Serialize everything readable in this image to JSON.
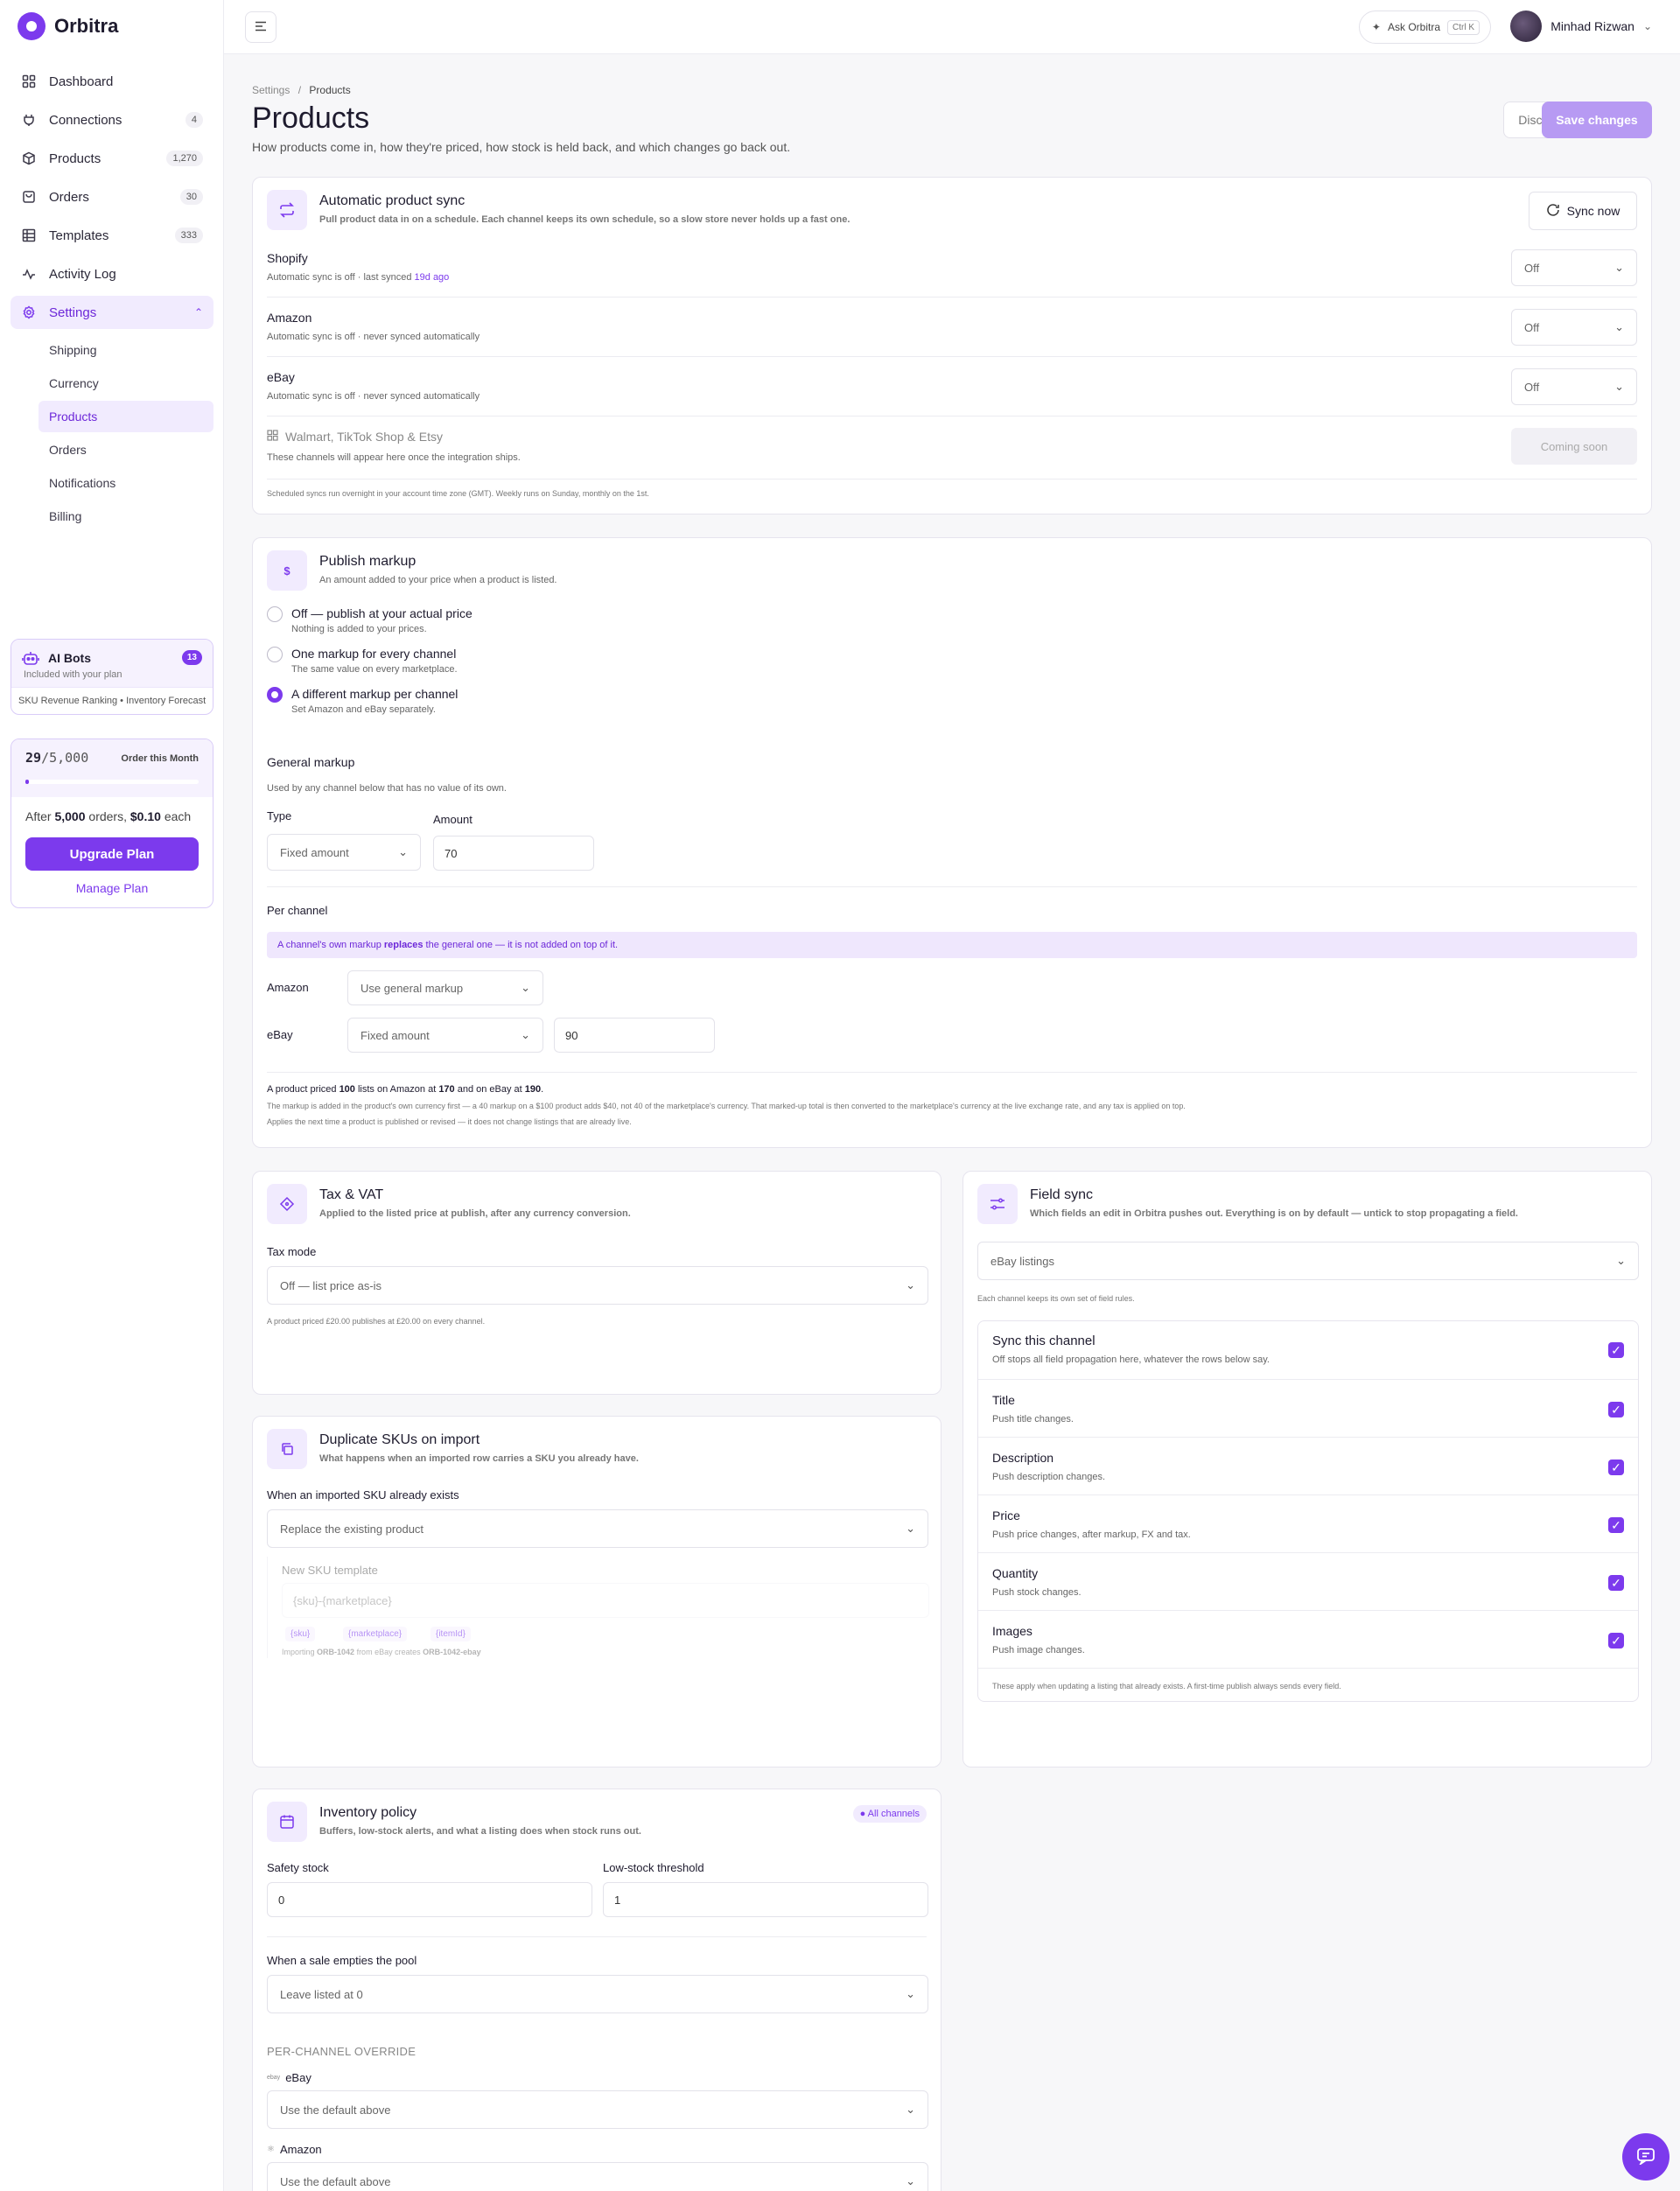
{
  "app": {
    "name": "Orbitra"
  },
  "sidebar": {
    "items": [
      {
        "label": "Dashboard",
        "icon": "dashboard-icon",
        "count": ""
      },
      {
        "label": "Connections",
        "icon": "plug-icon",
        "count": "4"
      },
      {
        "label": "Products",
        "icon": "box-icon",
        "count": "1,270"
      },
      {
        "label": "Orders",
        "icon": "bag-icon",
        "count": "30"
      },
      {
        "label": "Templates",
        "icon": "grid-icon",
        "count": "333"
      },
      {
        "label": "Activity Log",
        "icon": "activity-icon",
        "count": ""
      },
      {
        "label": "Settings",
        "icon": "gear-icon",
        "count": ""
      }
    ],
    "settings_sub": [
      "Shipping",
      "Currency",
      "Products",
      "Orders",
      "Notifications",
      "Billing"
    ],
    "bots": {
      "title": "AI Bots",
      "badge": "13",
      "sub": "Included with your plan",
      "tags": "SKU Revenue Ranking  •  Inventory Forecast"
    },
    "plan": {
      "used": "29",
      "limit": "/5,000",
      "label": "Order this Month",
      "progress": 0.006,
      "after": "After",
      "orders": "5,000",
      "orders_txt": "orders,",
      "price": "$0.10",
      "each": "each",
      "upgrade": "Upgrade Plan",
      "manage": "Manage Plan"
    }
  },
  "topbar": {
    "ask": "Ask Orbitra",
    "kbd": "Ctrl K",
    "user": "Minhad Rizwan"
  },
  "page": {
    "crumb_root": "Settings",
    "crumb_sep": "/",
    "crumb_current": "Products",
    "title": "Products",
    "subtitle": "How products come in, how they're priced, how stock is held back, and which changes go back out.",
    "discard": "Discard",
    "save": "Save changes"
  },
  "sync": {
    "title": "Automatic product sync",
    "sub": "Pull product data in on a schedule. Each channel keeps its own schedule, so a slow store never holds up a fast one.",
    "sync_now": "Sync now",
    "channels": [
      {
        "name": "Shopify",
        "status_pre": "Automatic sync is off · last synced ",
        "status_hl": "19d ago",
        "value": "Off"
      },
      {
        "name": "Amazon",
        "status_pre": "Automatic sync is off · never synced automatically",
        "status_hl": "",
        "value": "Off"
      },
      {
        "name": "eBay",
        "status_pre": "Automatic sync is off · never synced automatically",
        "status_hl": "",
        "value": "Off"
      }
    ],
    "coming_title": "Walmart, TikTok Shop & Etsy",
    "coming_sub": "These channels will appear here once the integration ships.",
    "coming_btn": "Coming soon",
    "footnote": "Scheduled syncs run overnight in your account time zone (GMT). Weekly runs on Sunday, monthly on the 1st."
  },
  "markup": {
    "icon": "$",
    "title": "Publish markup",
    "sub": "An amount added to your price when a product is listed.",
    "options": [
      {
        "title": "Off — publish at your actual price",
        "sub": "Nothing is added to your prices.",
        "selected": false
      },
      {
        "title": "One markup for every channel",
        "sub": "The same value on every marketplace.",
        "selected": false
      },
      {
        "title": "A different markup per channel",
        "sub": "Set Amazon and eBay separately.",
        "selected": true
      }
    ],
    "general_title": "General markup",
    "general_sub": "Used by any channel below that has no value of its own.",
    "type_label": "Type",
    "type_value": "Fixed amount",
    "amount_label": "Amount",
    "amount_value": "70",
    "per_channel": "Per channel",
    "note_pre": "A channel's own markup",
    "note_bold": "replaces",
    "note_post": "the general one — it is not added on top of it.",
    "amazon_label": "Amazon",
    "amazon_value": "Use general markup",
    "ebay_label": "eBay",
    "ebay_value": "Fixed amount",
    "ebay_amount": "90",
    "example_1": "A product priced ",
    "example_100": "100",
    "example_2": " lists on Amazon at ",
    "example_170": "170",
    "example_3": " and on eBay at ",
    "example_190": "190",
    "example_4": ".",
    "explain": "The markup is added in the product's own currency first — a 40 markup on a $100 product adds $40, not 40 of the marketplace's currency. That marked-up total is then converted to the marketplace's currency at the live exchange rate, and any tax is applied on top.",
    "applies": "Applies the next time a product is published or revised — it does not change listings that are already live."
  },
  "tax": {
    "title": "Tax & VAT",
    "sub": "Applied to the listed price at publish, after any currency conversion.",
    "mode_label": "Tax mode",
    "mode_value": "Off — list price as-is",
    "note": "A product priced £20.00 publishes at £20.00 on every channel."
  },
  "dup": {
    "title": "Duplicate SKUs on import",
    "sub": "What happens when an imported row carries a SKU you already have.",
    "when_label": "When an imported SKU already exists",
    "when_value": "Replace the existing product",
    "tmpl_label": "New SKU template",
    "tmpl_placeholder": "{sku}-{marketplace}",
    "chips": [
      "{sku}",
      "{marketplace}",
      "{itemId}"
    ],
    "ex_1": "Importing ",
    "ex_sku": "ORB-1042",
    "ex_2": " from eBay creates ",
    "ex_new": "ORB-1042-ebay"
  },
  "field_sync": {
    "title": "Field sync",
    "sub": "Which fields an edit in Orbitra pushes out. Everything is on by default — untick to stop propagating a field.",
    "channel": "eBay listings",
    "channel_note": "Each channel keeps its own set of field rules.",
    "rows": [
      {
        "title": "Sync this channel",
        "sub": "Off stops all field propagation here, whatever the rows below say."
      },
      {
        "title": "Title",
        "sub": "Push title changes."
      },
      {
        "title": "Description",
        "sub": "Push description changes."
      },
      {
        "title": "Price",
        "sub": "Push price changes, after markup, FX and tax."
      },
      {
        "title": "Quantity",
        "sub": "Push stock changes."
      },
      {
        "title": "Images",
        "sub": "Push image changes."
      }
    ],
    "footnote": "These apply when updating a listing that already exists. A first-time publish always sends every field."
  },
  "inventory": {
    "title": "Inventory policy",
    "sub": "Buffers, low-stock alerts, and what a listing does when stock runs out.",
    "badge": "All channels",
    "safety_label": "Safety stock",
    "safety_value": "0",
    "low_label": "Low-stock threshold",
    "low_value": "1",
    "empties_label": "When a sale empties the pool",
    "empties_value": "Leave listed at 0",
    "override_title": "PER-CHANNEL OVERRIDE",
    "ebay_label": "eBay",
    "ebay_value": "Use the default above",
    "amazon_label": "Amazon",
    "amazon_value": "Use the default above"
  },
  "colors": {
    "accent": "#7c3aed",
    "accent_soft": "#f1ebfe",
    "save_disabled": "#b79af3"
  }
}
